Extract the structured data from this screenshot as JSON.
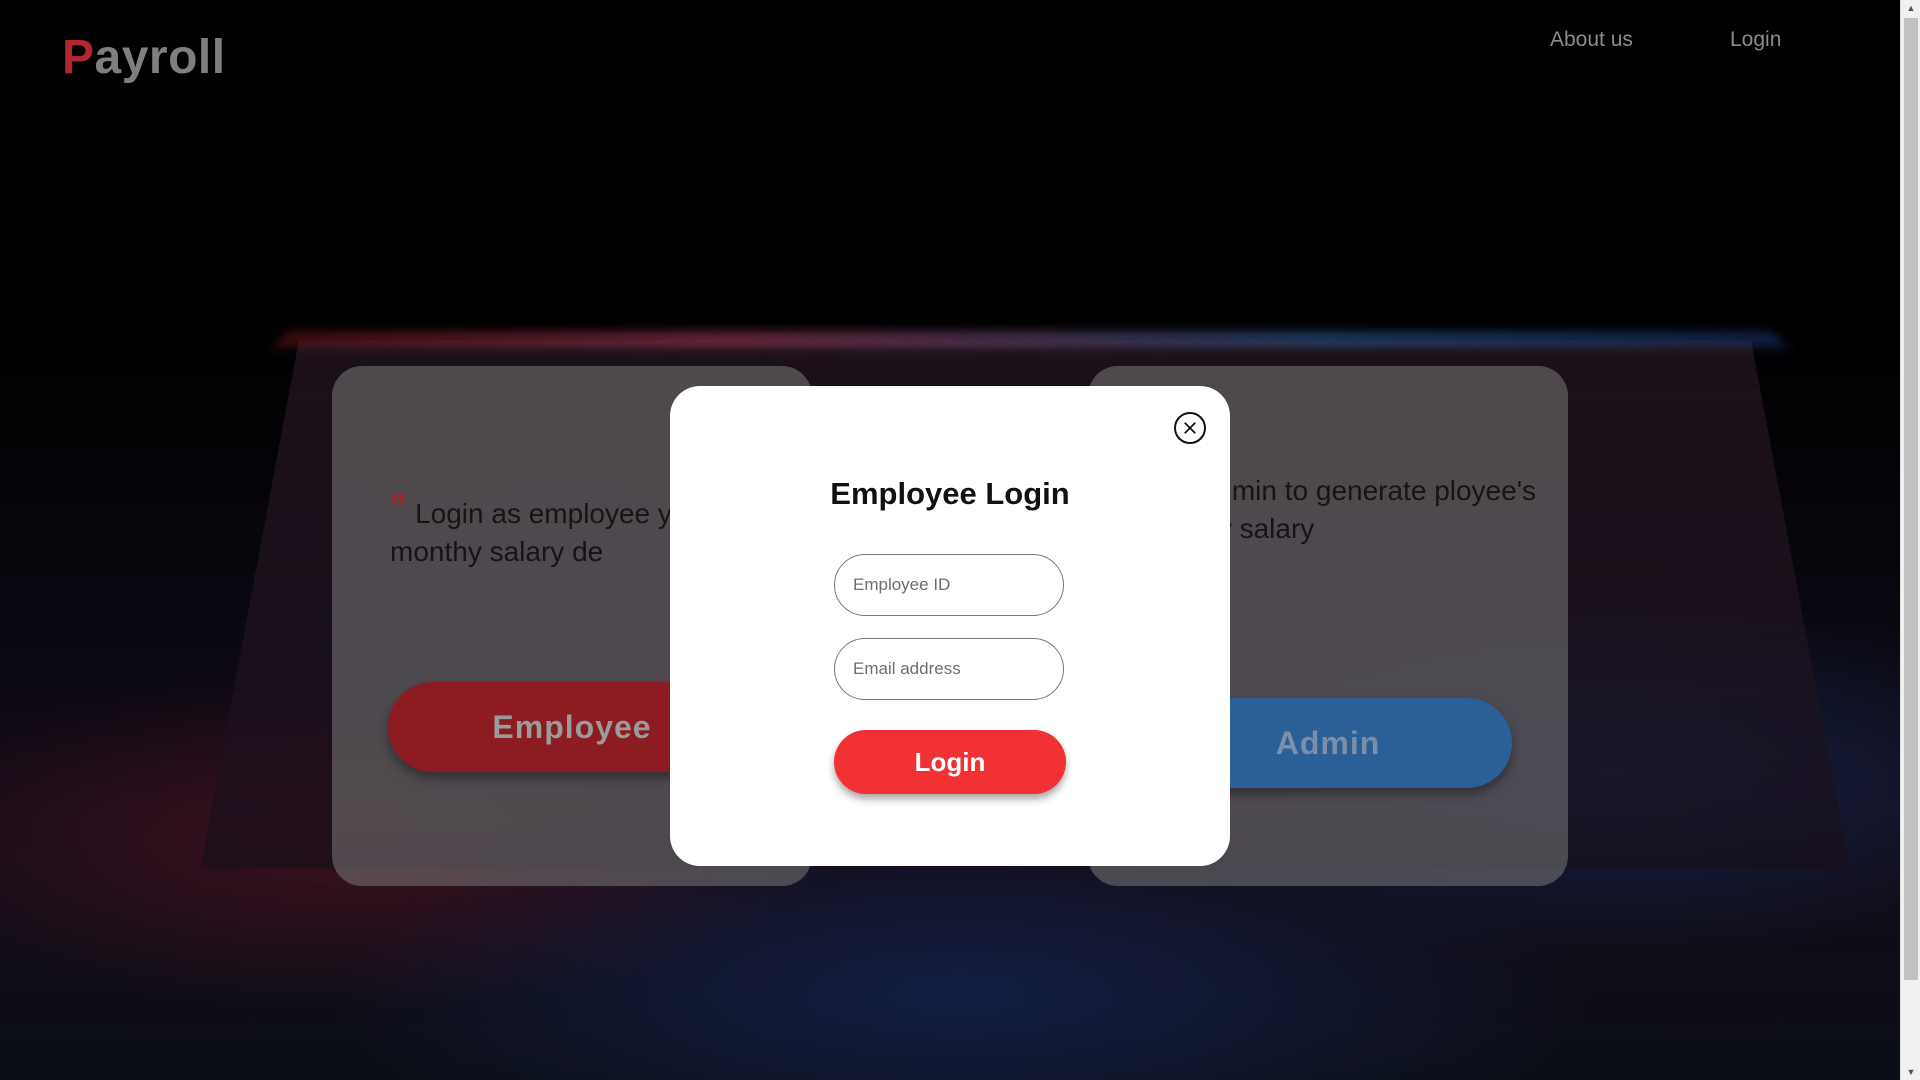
{
  "header": {
    "logo_first": "P",
    "logo_rest": "ayroll",
    "nav": {
      "about": "About us",
      "login": "Login"
    }
  },
  "cards": {
    "employee": {
      "quote": "\"",
      "text": "Login as employee your monthy salary de",
      "button": "Employee"
    },
    "admin": {
      "text": "n as admin to generate ployee's monthy salary",
      "button": "Admin"
    }
  },
  "modal": {
    "title": "Employee Login",
    "employee_id_placeholder": "Employee ID",
    "email_placeholder": "Email address",
    "login_button": "Login"
  },
  "icons": {
    "close": "close-icon",
    "scroll_up": "chevron-up-icon",
    "scroll_down": "chevron-down-icon"
  },
  "colors": {
    "brand_red": "#f13134",
    "logo_red": "#b2262d",
    "admin_blue": "#2a5f98"
  }
}
